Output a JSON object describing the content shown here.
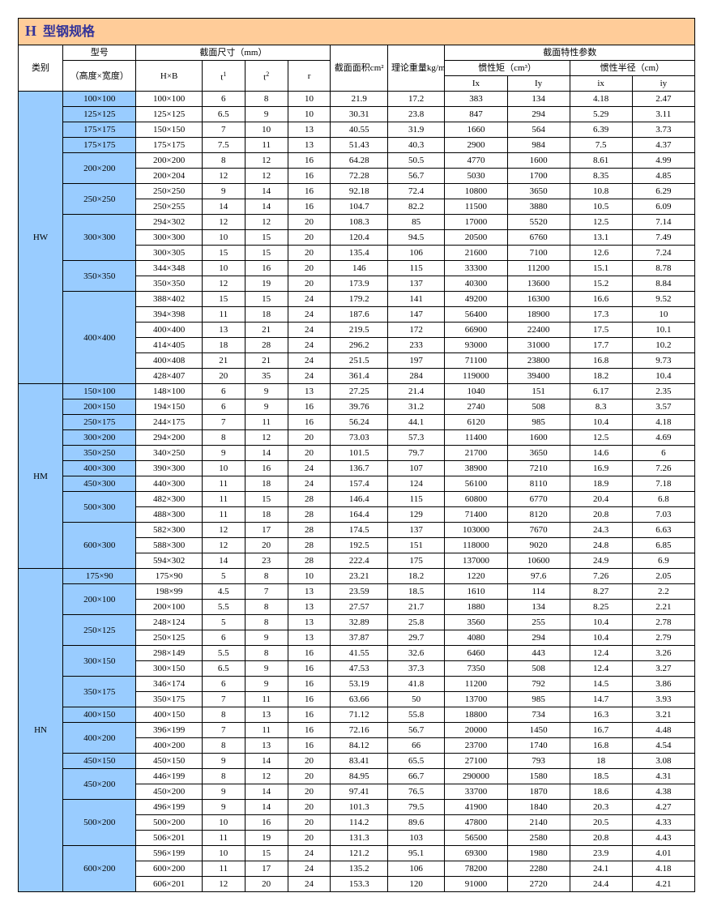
{
  "title_prefix": "H",
  "title": "型钢规格",
  "headers": {
    "category": "类别",
    "model": "型号",
    "model_sub": "（高度×宽度）",
    "section_dim": "截面尺寸（mm）",
    "HxB": "H×B",
    "t1": "t",
    "t2": "t",
    "r": "r",
    "area": "截面面积cm²",
    "weight": "理论重量kg/m",
    "props": "截面特性参数",
    "inertia": "惯性矩（cm³）",
    "radius": "惯性半径（cm）",
    "Ix": "Ix",
    "Iy": "Iy",
    "ix": "ix",
    "iy": "iy"
  },
  "groups": [
    {
      "cat": "HW",
      "blocks": [
        {
          "model": "100×100",
          "rows": [
            [
              "100×100",
              "6",
              "8",
              "10",
              "21.9",
              "17.2",
              "383",
              "134",
              "4.18",
              "2.47"
            ]
          ]
        },
        {
          "model": "125×125",
          "rows": [
            [
              "125×125",
              "6.5",
              "9",
              "10",
              "30.31",
              "23.8",
              "847",
              "294",
              "5.29",
              "3.11"
            ]
          ]
        },
        {
          "model": "175×175",
          "rows": [
            [
              "150×150",
              "7",
              "10",
              "13",
              "40.55",
              "31.9",
              "1660",
              "564",
              "6.39",
              "3.73"
            ]
          ]
        },
        {
          "model": "175×175",
          "rows": [
            [
              "175×175",
              "7.5",
              "11",
              "13",
              "51.43",
              "40.3",
              "2900",
              "984",
              "7.5",
              "4.37"
            ]
          ]
        },
        {
          "model": "200×200",
          "rows": [
            [
              "200×200",
              "8",
              "12",
              "16",
              "64.28",
              "50.5",
              "4770",
              "1600",
              "8.61",
              "4.99"
            ],
            [
              "200×204",
              "12",
              "12",
              "16",
              "72.28",
              "56.7",
              "5030",
              "1700",
              "8.35",
              "4.85"
            ]
          ]
        },
        {
          "model": "250×250",
          "rows": [
            [
              "250×250",
              "9",
              "14",
              "16",
              "92.18",
              "72.4",
              "10800",
              "3650",
              "10.8",
              "6.29"
            ],
            [
              "250×255",
              "14",
              "14",
              "16",
              "104.7",
              "82.2",
              "11500",
              "3880",
              "10.5",
              "6.09"
            ]
          ]
        },
        {
          "model": "300×300",
          "rows": [
            [
              "294×302",
              "12",
              "12",
              "20",
              "108.3",
              "85",
              "17000",
              "5520",
              "12.5",
              "7.14"
            ],
            [
              "300×300",
              "10",
              "15",
              "20",
              "120.4",
              "94.5",
              "20500",
              "6760",
              "13.1",
              "7.49"
            ],
            [
              "300×305",
              "15",
              "15",
              "20",
              "135.4",
              "106",
              "21600",
              "7100",
              "12.6",
              "7.24"
            ]
          ]
        },
        {
          "model": "350×350",
          "rows": [
            [
              "344×348",
              "10",
              "16",
              "20",
              "146",
              "115",
              "33300",
              "11200",
              "15.1",
              "8.78"
            ],
            [
              "350×350",
              "12",
              "19",
              "20",
              "173.9",
              "137",
              "40300",
              "13600",
              "15.2",
              "8.84"
            ]
          ]
        },
        {
          "model": "400×400",
          "rows": [
            [
              "388×402",
              "15",
              "15",
              "24",
              "179.2",
              "141",
              "49200",
              "16300",
              "16.6",
              "9.52"
            ],
            [
              "394×398",
              "11",
              "18",
              "24",
              "187.6",
              "147",
              "56400",
              "18900",
              "17.3",
              "10"
            ],
            [
              "400×400",
              "13",
              "21",
              "24",
              "219.5",
              "172",
              "66900",
              "22400",
              "17.5",
              "10.1"
            ],
            [
              "414×405",
              "18",
              "28",
              "24",
              "296.2",
              "233",
              "93000",
              "31000",
              "17.7",
              "10.2"
            ],
            [
              "400×408",
              "21",
              "21",
              "24",
              "251.5",
              "197",
              "71100",
              "23800",
              "16.8",
              "9.73"
            ],
            [
              "428×407",
              "20",
              "35",
              "24",
              "361.4",
              "284",
              "119000",
              "39400",
              "18.2",
              "10.4"
            ]
          ]
        }
      ]
    },
    {
      "cat": "HM",
      "blocks": [
        {
          "model": "150×100",
          "rows": [
            [
              "148×100",
              "6",
              "9",
              "13",
              "27.25",
              "21.4",
              "1040",
              "151",
              "6.17",
              "2.35"
            ]
          ]
        },
        {
          "model": "200×150",
          "rows": [
            [
              "194×150",
              "6",
              "9",
              "16",
              "39.76",
              "31.2",
              "2740",
              "508",
              "8.3",
              "3.57"
            ]
          ]
        },
        {
          "model": "250×175",
          "rows": [
            [
              "244×175",
              "7",
              "11",
              "16",
              "56.24",
              "44.1",
              "6120",
              "985",
              "10.4",
              "4.18"
            ]
          ]
        },
        {
          "model": "300×200",
          "rows": [
            [
              "294×200",
              "8",
              "12",
              "20",
              "73.03",
              "57.3",
              "11400",
              "1600",
              "12.5",
              "4.69"
            ]
          ]
        },
        {
          "model": "350×250",
          "rows": [
            [
              "340×250",
              "9",
              "14",
              "20",
              "101.5",
              "79.7",
              "21700",
              "3650",
              "14.6",
              "6"
            ]
          ]
        },
        {
          "model": "400×300",
          "rows": [
            [
              "390×300",
              "10",
              "16",
              "24",
              "136.7",
              "107",
              "38900",
              "7210",
              "16.9",
              "7.26"
            ]
          ]
        },
        {
          "model": "450×300",
          "rows": [
            [
              "440×300",
              "11",
              "18",
              "24",
              "157.4",
              "124",
              "56100",
              "8110",
              "18.9",
              "7.18"
            ]
          ]
        },
        {
          "model": "500×300",
          "rows": [
            [
              "482×300",
              "11",
              "15",
              "28",
              "146.4",
              "115",
              "60800",
              "6770",
              "20.4",
              "6.8"
            ],
            [
              "488×300",
              "11",
              "18",
              "28",
              "164.4",
              "129",
              "71400",
              "8120",
              "20.8",
              "7.03"
            ]
          ]
        },
        {
          "model": "600×300",
          "rows": [
            [
              "582×300",
              "12",
              "17",
              "28",
              "174.5",
              "137",
              "103000",
              "7670",
              "24.3",
              "6.63"
            ],
            [
              "588×300",
              "12",
              "20",
              "28",
              "192.5",
              "151",
              "118000",
              "9020",
              "24.8",
              "6.85"
            ],
            [
              "594×302",
              "14",
              "23",
              "28",
              "222.4",
              "175",
              "137000",
              "10600",
              "24.9",
              "6.9"
            ]
          ]
        }
      ]
    },
    {
      "cat": "HN",
      "blocks": [
        {
          "model": "175×90",
          "rows": [
            [
              "175×90",
              "5",
              "8",
              "10",
              "23.21",
              "18.2",
              "1220",
              "97.6",
              "7.26",
              "2.05"
            ]
          ]
        },
        {
          "model": "200×100",
          "rows": [
            [
              "198×99",
              "4.5",
              "7",
              "13",
              "23.59",
              "18.5",
              "1610",
              "114",
              "8.27",
              "2.2"
            ],
            [
              "200×100",
              "5.5",
              "8",
              "13",
              "27.57",
              "21.7",
              "1880",
              "134",
              "8.25",
              "2.21"
            ]
          ]
        },
        {
          "model": "250×125",
          "rows": [
            [
              "248×124",
              "5",
              "8",
              "13",
              "32.89",
              "25.8",
              "3560",
              "255",
              "10.4",
              "2.78"
            ],
            [
              "250×125",
              "6",
              "9",
              "13",
              "37.87",
              "29.7",
              "4080",
              "294",
              "10.4",
              "2.79"
            ]
          ]
        },
        {
          "model": "300×150",
          "rows": [
            [
              "298×149",
              "5.5",
              "8",
              "16",
              "41.55",
              "32.6",
              "6460",
              "443",
              "12.4",
              "3.26"
            ],
            [
              "300×150",
              "6.5",
              "9",
              "16",
              "47.53",
              "37.3",
              "7350",
              "508",
              "12.4",
              "3.27"
            ]
          ]
        },
        {
          "model": "350×175",
          "rows": [
            [
              "346×174",
              "6",
              "9",
              "16",
              "53.19",
              "41.8",
              "11200",
              "792",
              "14.5",
              "3.86"
            ],
            [
              "350×175",
              "7",
              "11",
              "16",
              "63.66",
              "50",
              "13700",
              "985",
              "14.7",
              "3.93"
            ]
          ]
        },
        {
          "model": "400×150",
          "rows": [
            [
              "400×150",
              "8",
              "13",
              "16",
              "71.12",
              "55.8",
              "18800",
              "734",
              "16.3",
              "3.21"
            ]
          ]
        },
        {
          "model": "400×200",
          "rows": [
            [
              "396×199",
              "7",
              "11",
              "16",
              "72.16",
              "56.7",
              "20000",
              "1450",
              "16.7",
              "4.48"
            ],
            [
              "400×200",
              "8",
              "13",
              "16",
              "84.12",
              "66",
              "23700",
              "1740",
              "16.8",
              "4.54"
            ]
          ]
        },
        {
          "model": "450×150",
          "rows": [
            [
              "450×150",
              "9",
              "14",
              "20",
              "83.41",
              "65.5",
              "27100",
              "793",
              "18",
              "3.08"
            ]
          ]
        },
        {
          "model": "450×200",
          "rows": [
            [
              "446×199",
              "8",
              "12",
              "20",
              "84.95",
              "66.7",
              "290000",
              "1580",
              "18.5",
              "4.31"
            ],
            [
              "450×200",
              "9",
              "14",
              "20",
              "97.41",
              "76.5",
              "33700",
              "1870",
              "18.6",
              "4.38"
            ]
          ]
        },
        {
          "model": "500×200",
          "rows": [
            [
              "496×199",
              "9",
              "14",
              "20",
              "101.3",
              "79.5",
              "41900",
              "1840",
              "20.3",
              "4.27"
            ],
            [
              "500×200",
              "10",
              "16",
              "20",
              "114.2",
              "89.6",
              "47800",
              "2140",
              "20.5",
              "4.33"
            ],
            [
              "506×201",
              "11",
              "19",
              "20",
              "131.3",
              "103",
              "56500",
              "2580",
              "20.8",
              "4.43"
            ]
          ]
        },
        {
          "model": "600×200",
          "rows": [
            [
              "596×199",
              "10",
              "15",
              "24",
              "121.2",
              "95.1",
              "69300",
              "1980",
              "23.9",
              "4.01"
            ],
            [
              "600×200",
              "11",
              "17",
              "24",
              "135.2",
              "106",
              "78200",
              "2280",
              "24.1",
              "4.18"
            ],
            [
              "606×201",
              "12",
              "20",
              "24",
              "153.3",
              "120",
              "91000",
              "2720",
              "24.4",
              "4.21"
            ]
          ]
        }
      ]
    }
  ]
}
